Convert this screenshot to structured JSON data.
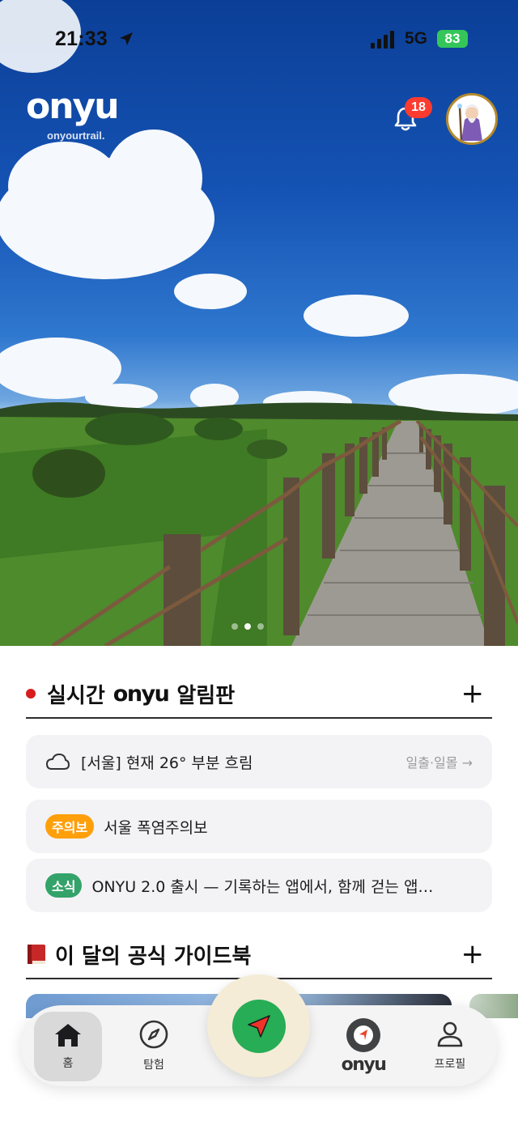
{
  "status_bar": {
    "time": "21:33",
    "network": "5G",
    "battery": "83"
  },
  "header": {
    "logo": "onyu",
    "tagline": "onyourtrail.",
    "notification_count": "18"
  },
  "hero": {
    "slides": 3,
    "active_slide": 2
  },
  "live_board": {
    "title_prefix": "실시간",
    "title_brand": "onyu",
    "title_suffix": "알림판",
    "add_label": "+",
    "weather": {
      "text": "[서울] 현재 26° 부분 흐림",
      "link": "일출·일몰 →"
    },
    "alert": {
      "tag": "주의보",
      "text": "서울 폭염주의보"
    },
    "news": {
      "tag": "소식",
      "text": "ONYU 2.0 출시 — 기록하는 앱에서, 함께 걷는 앱…"
    }
  },
  "guidebook": {
    "icon": "book-icon",
    "title": "이 달의 공식 가이드북",
    "add_label": "+"
  },
  "tabbar": {
    "home": "홈",
    "explore": "탐험",
    "center_logo": "onyu",
    "profile": "프로필"
  },
  "colors": {
    "accent_green": "#27ad55",
    "alert_orange": "#ff9f0a",
    "news_green": "#34a36a",
    "badge_red": "#ff3b30"
  }
}
